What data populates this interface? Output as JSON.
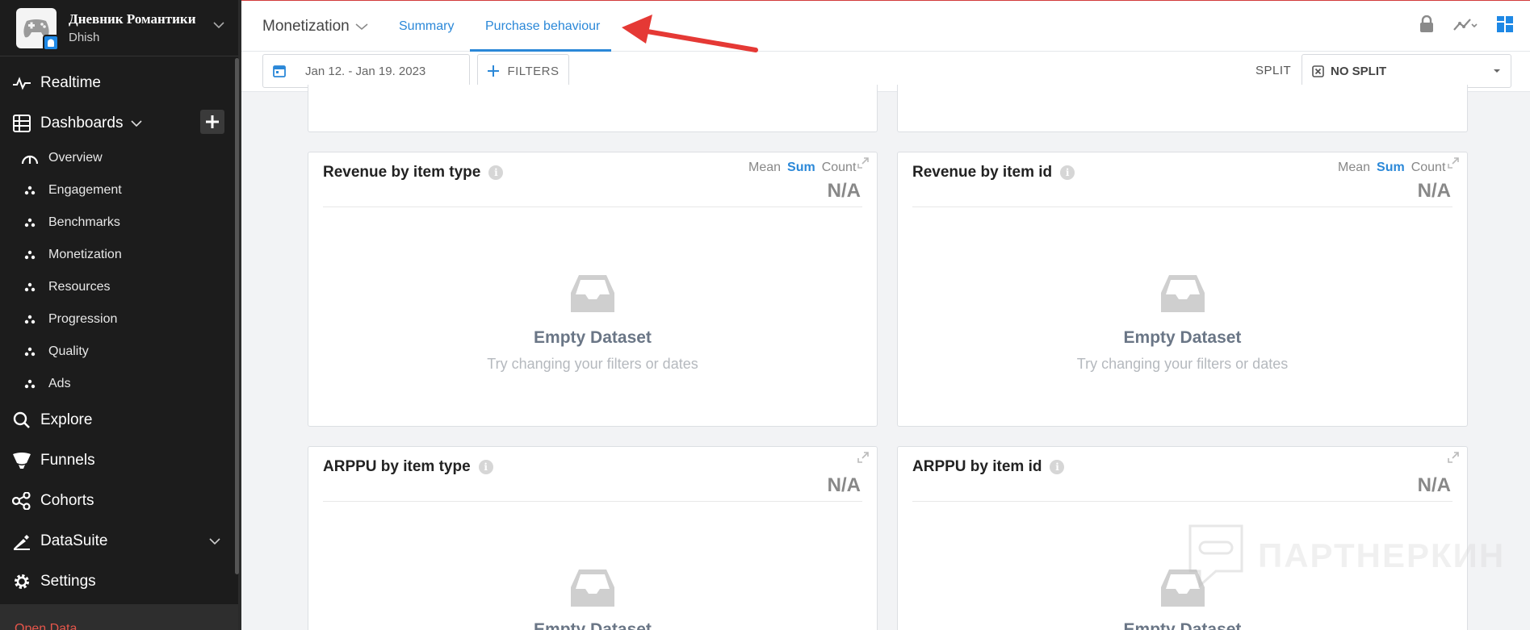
{
  "app": {
    "name": "Дневник Романтики",
    "subtitle": "Dhish"
  },
  "nav": {
    "realtime": "Realtime",
    "dashboards": "Dashboards",
    "dashboard_items": [
      "Overview",
      "Engagement",
      "Benchmarks",
      "Monetization",
      "Resources",
      "Progression",
      "Quality",
      "Ads"
    ],
    "explore": "Explore",
    "funnels": "Funnels",
    "cohorts": "Cohorts",
    "datasuite": "DataSuite",
    "settings": "Settings",
    "bottom": "Open Data..."
  },
  "header": {
    "breadcrumb": "Monetization",
    "tabs": [
      "Summary",
      "Purchase behaviour"
    ],
    "active_tab": "Purchase behaviour"
  },
  "filters": {
    "date_range": "Jan 12. - Jan 19. 2023",
    "filters_label": "FILTERS",
    "split_label": "SPLIT",
    "split_value": "NO SPLIT"
  },
  "cards": [
    {
      "title": "Revenue by item type",
      "agg": [
        "Mean",
        "Sum",
        "Count"
      ],
      "agg_active": "Sum",
      "value": "N/A",
      "empty_title": "Empty Dataset",
      "empty_sub": "Try changing your filters or dates"
    },
    {
      "title": "Revenue by item id",
      "agg": [
        "Mean",
        "Sum",
        "Count"
      ],
      "agg_active": "Sum",
      "value": "N/A",
      "empty_title": "Empty Dataset",
      "empty_sub": "Try changing your filters or dates"
    },
    {
      "title": "ARPPU by item type",
      "value": "N/A",
      "empty_title": "Empty Dataset"
    },
    {
      "title": "ARPPU by item id",
      "value": "N/A",
      "empty_title": "Empty Dataset"
    }
  ],
  "watermark": "ПАРТНЕРКИН",
  "colors": {
    "accent": "#2b88d8",
    "sidebar": "#1c1c1c",
    "arrow": "#e53935"
  }
}
